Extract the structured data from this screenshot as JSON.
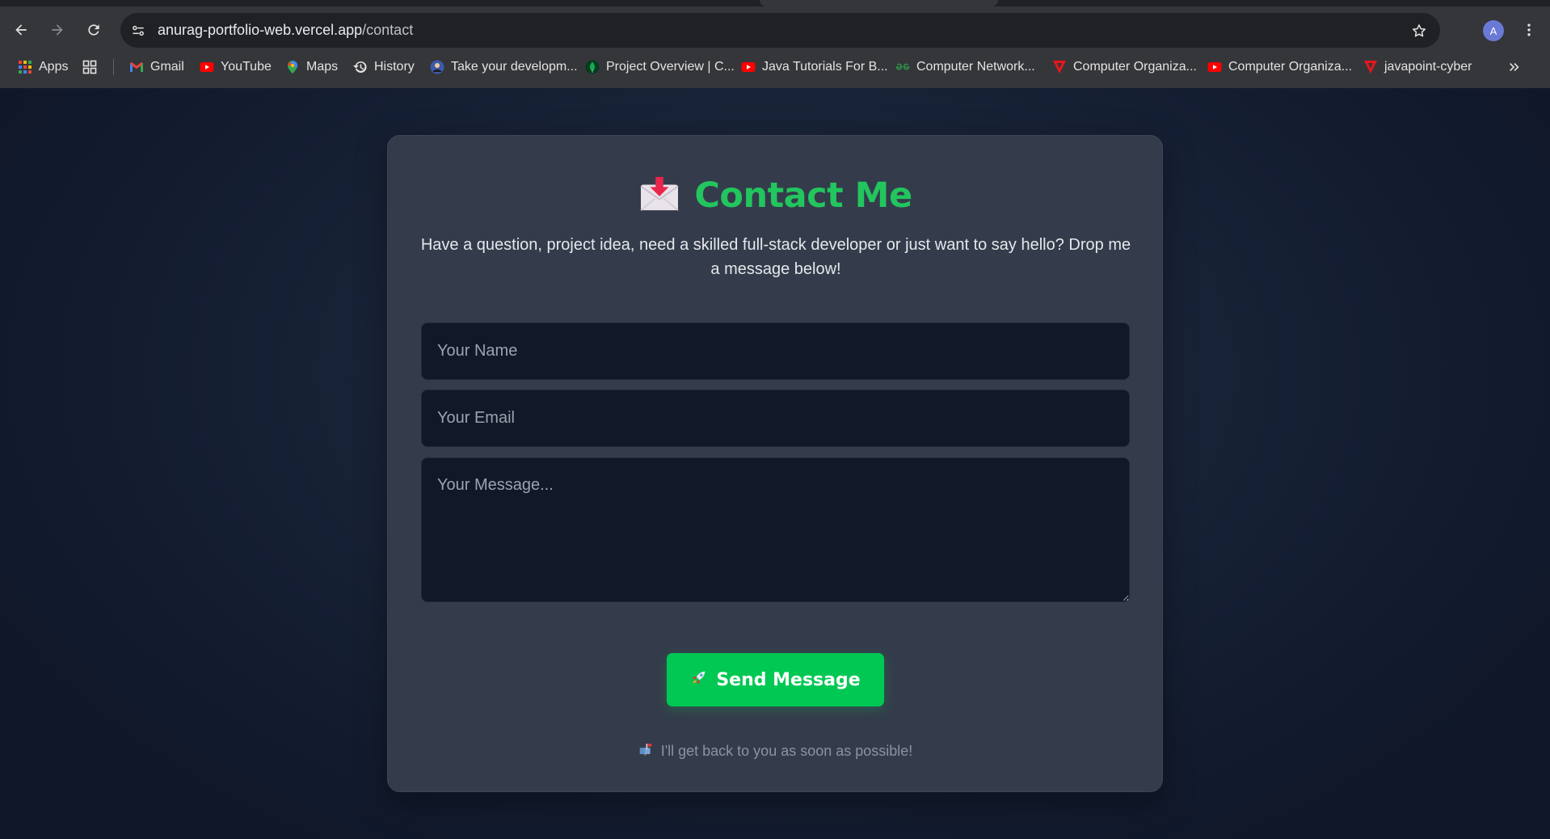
{
  "browser": {
    "url_host": "anurag-portfolio-web.vercel.app",
    "url_path": "/contact",
    "profile_initial": "A",
    "bookmarks": [
      {
        "label": "Apps",
        "icon": "apps-grid-icon"
      },
      {
        "label": "Gmail",
        "icon": "gmail-icon"
      },
      {
        "label": "YouTube",
        "icon": "youtube-icon"
      },
      {
        "label": "Maps",
        "icon": "maps-pin-icon"
      },
      {
        "label": "History",
        "icon": "history-icon"
      },
      {
        "label": "Take your developm...",
        "icon": "avatar-icon"
      },
      {
        "label": "Project Overview | C...",
        "icon": "mongodb-leaf-icon"
      },
      {
        "label": "Java Tutorials For B...",
        "icon": "youtube-icon"
      },
      {
        "label": "Computer Network...",
        "icon": "geeksforgeeks-icon"
      },
      {
        "label": "Computer Organiza...",
        "icon": "javatpoint-icon"
      },
      {
        "label": "Computer Organiza...",
        "icon": "youtube-icon"
      },
      {
        "label": "javapoint-cyber",
        "icon": "javatpoint-icon"
      }
    ]
  },
  "contact": {
    "title": "Contact Me",
    "title_icon": "envelope-incoming-icon",
    "intro": "Have a question, project idea, need a skilled full-stack developer or just want to say hello? Drop me a message below!",
    "name_placeholder": "Your Name",
    "email_placeholder": "Your Email",
    "message_placeholder": "Your Message...",
    "send_label": "Send Message",
    "send_icon": "rocket-icon",
    "footnote": "I'll get back to you as soon as possible!",
    "footnote_icon": "mailbox-icon"
  },
  "colors": {
    "accent_green": "#22c55e",
    "button_green": "#00c853",
    "card_bg": "#343c4b",
    "field_bg": "#111827"
  }
}
